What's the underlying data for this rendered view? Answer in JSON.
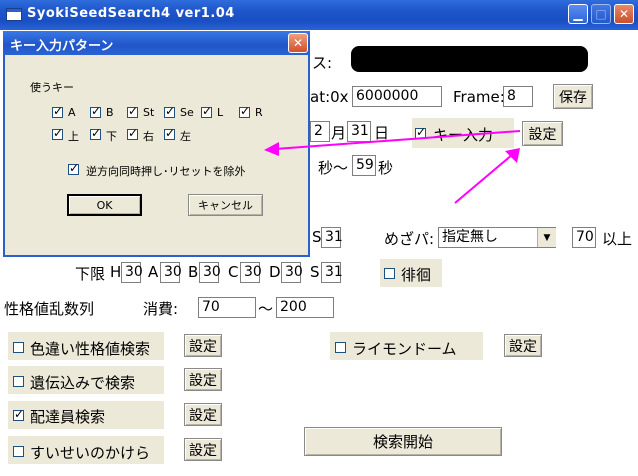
{
  "window": {
    "title": "SyokiSeedSearch4 ver1.04"
  },
  "dialog": {
    "title": "キー入力パターン",
    "group_label": "使うキー",
    "keys_row1": [
      "A",
      "B",
      "St",
      "Se",
      "L",
      "R"
    ],
    "keys_row2": [
      "上",
      "下",
      "右",
      "左"
    ],
    "reverse_label": "逆方向同時押し･リセットを除外",
    "ok_label": "OK",
    "cancel_label": "キャンセル"
  },
  "main": {
    "address_label": "ス:",
    "seed_label": "at:0x",
    "seed_value": "6000000",
    "frame_label": "Frame:",
    "frame_value": "8",
    "save_button": "保存",
    "month_value": "2",
    "month_label": "月",
    "day_value": "31",
    "day_label": "日",
    "key_input_label": "キー入力",
    "settings_label": "設定",
    "sec_from_label": "秒～",
    "sec_to_value": "59",
    "sec_to_label": "秒",
    "upper_s_value": "31",
    "mezapa_label": "めざパ:",
    "mezapa_value": "指定無し",
    "mezapa_power_value": "70",
    "mezapa_above_label": "以上",
    "lower_label": "下限",
    "lower_stats": [
      {
        "label": "H",
        "value": "30"
      },
      {
        "label": "A",
        "value": "30"
      },
      {
        "label": "B",
        "value": "30"
      },
      {
        "label": "C",
        "value": "30"
      },
      {
        "label": "D",
        "value": "30"
      },
      {
        "label": "S",
        "value": "31"
      }
    ],
    "wander_label": "徘徊",
    "nature_seq_label": "性格値乱数列",
    "consume_label": "消費:",
    "consume_from": "70",
    "tilde": "～",
    "consume_to": "200",
    "options": [
      {
        "label": "色違い性格値検索",
        "checked": false
      },
      {
        "label": "遺伝込みで検索",
        "checked": false
      },
      {
        "label": "配達員検索",
        "checked": true
      },
      {
        "label": "すいせいのかけら",
        "checked": false
      }
    ],
    "raimon_label": "ライモンドーム",
    "search_start": "検索開始",
    "arrow_color": "#ff00ff"
  }
}
